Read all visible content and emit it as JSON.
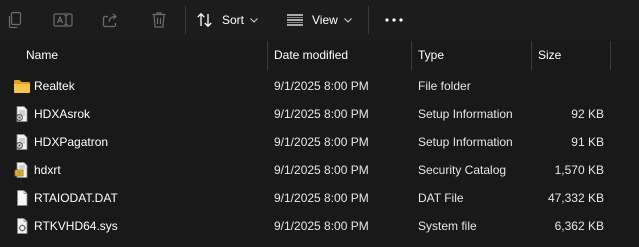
{
  "toolbar": {
    "sort_label": "Sort",
    "view_label": "View",
    "icons": [
      "copy-icon",
      "rename-icon",
      "share-icon",
      "delete-icon",
      "sort-icon",
      "view-icon",
      "more-icon"
    ]
  },
  "columns": {
    "name": "Name",
    "date": "Date modified",
    "type": "Type",
    "size": "Size"
  },
  "files": [
    {
      "name": "Realtek",
      "date": "9/1/2025 8:00 PM",
      "type": "File folder",
      "size": "",
      "icon": "folder-icon"
    },
    {
      "name": "HDXAsrok",
      "date": "9/1/2025 8:00 PM",
      "type": "Setup Information",
      "size": "92 KB",
      "icon": "setup-info-icon"
    },
    {
      "name": "HDXPagatron",
      "date": "9/1/2025 8:00 PM",
      "type": "Setup Information",
      "size": "91 KB",
      "icon": "setup-info-icon"
    },
    {
      "name": "hdxrt",
      "date": "9/1/2025 8:00 PM",
      "type": "Security Catalog",
      "size": "1,570 KB",
      "icon": "security-catalog-icon"
    },
    {
      "name": "RTAIODAT.DAT",
      "date": "9/1/2025 8:00 PM",
      "type": "DAT File",
      "size": "47,332 KB",
      "icon": "file-icon"
    },
    {
      "name": "RTKVHD64.sys",
      "date": "9/1/2025 8:00 PM",
      "type": "System file",
      "size": "6,362 KB",
      "icon": "system-file-icon"
    }
  ],
  "colors": {
    "background": "#191919",
    "text": "#ffffff",
    "disabled_icon": "#6d6d6d",
    "folder": "#f5c24a"
  }
}
